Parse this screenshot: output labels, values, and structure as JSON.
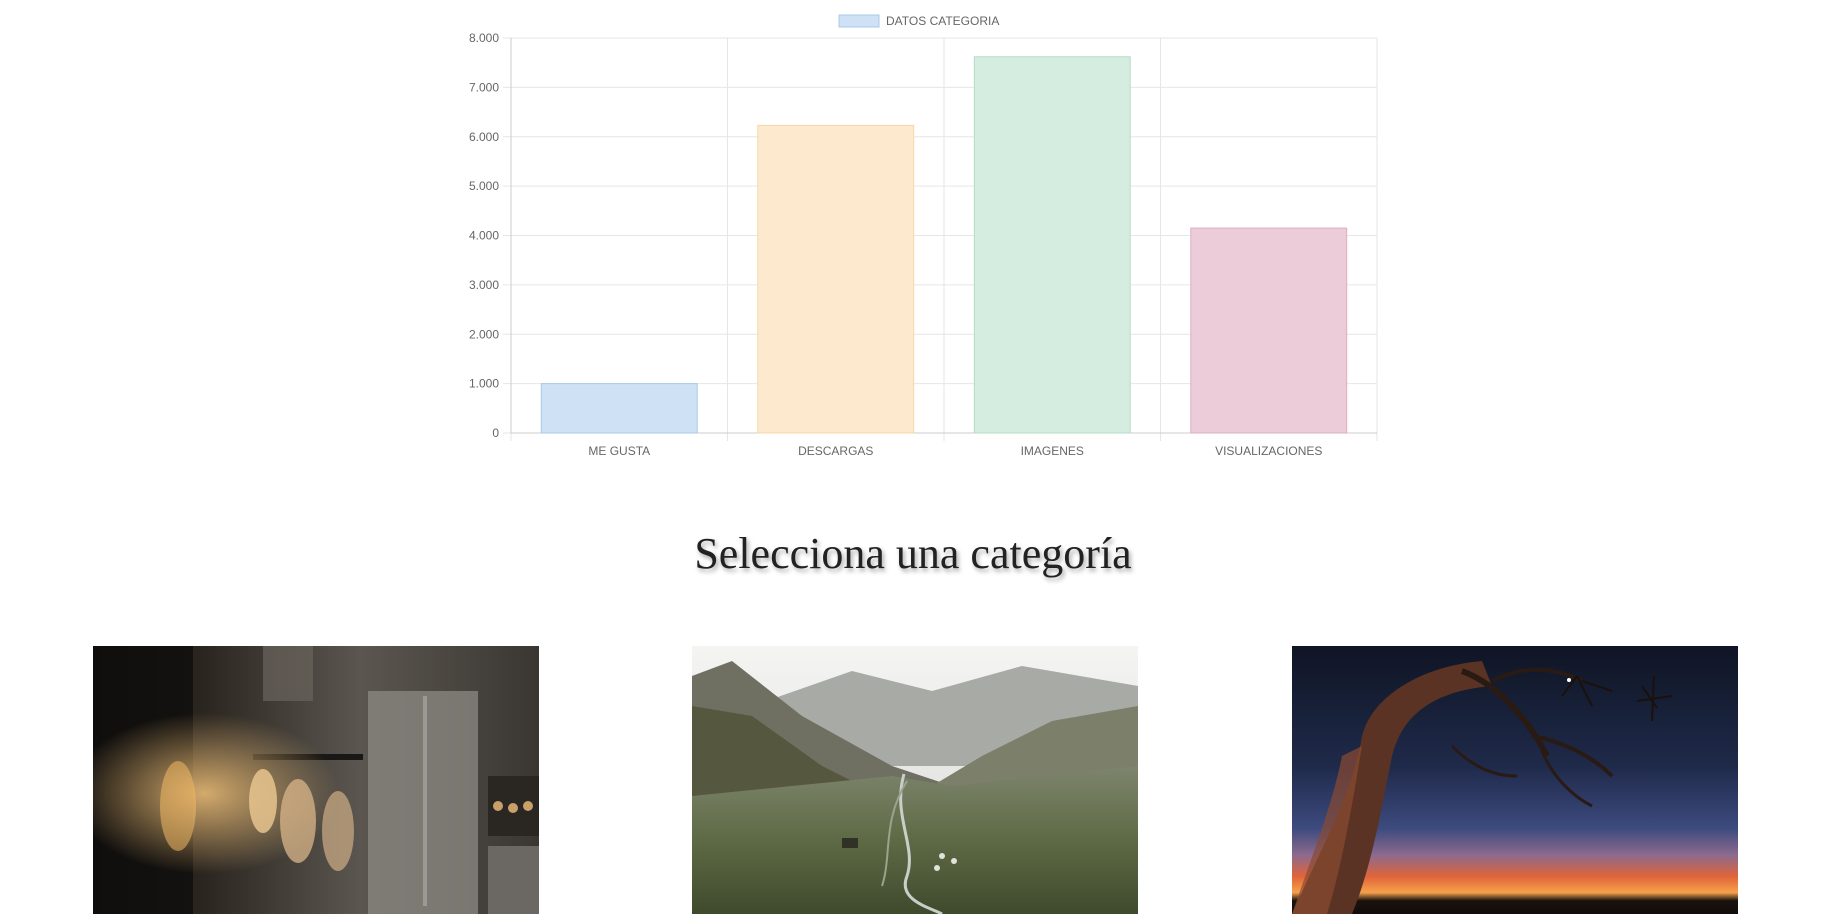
{
  "chart_data": {
    "type": "bar",
    "legend": {
      "label": "DATOS CATEGORIA",
      "position": "top-center"
    },
    "categories": [
      "ME GUSTA",
      "DESCARGAS",
      "IMAGENES",
      "VISUALIZACIONES"
    ],
    "series": [
      {
        "name": "DATOS CATEGORIA",
        "values": [
          1000,
          6230,
          7620,
          4150
        ]
      }
    ],
    "colors": {
      "fill": [
        "#cfe1f4",
        "#fde9cd",
        "#d5ece0",
        "#ecccd8"
      ],
      "border": [
        "#a9c8e8",
        "#f7d7a8",
        "#b6dcc6",
        "#dcaec0"
      ],
      "legend_box": "#cfe1f4"
    },
    "ylim": [
      0,
      8000
    ],
    "yticks": [
      0,
      1000,
      2000,
      3000,
      4000,
      5000,
      6000,
      7000,
      8000
    ],
    "ytick_labels": [
      "0",
      "1.000",
      "2.000",
      "3.000",
      "4.000",
      "5.000",
      "6.000",
      "7.000",
      "8.000"
    ],
    "grid": true
  },
  "section": {
    "title": "Selecciona una categoría"
  },
  "cards": [
    {
      "icon": "interior-kitchen-photo"
    },
    {
      "icon": "mountain-valley-photo"
    },
    {
      "icon": "tree-sunset-photo"
    }
  ]
}
